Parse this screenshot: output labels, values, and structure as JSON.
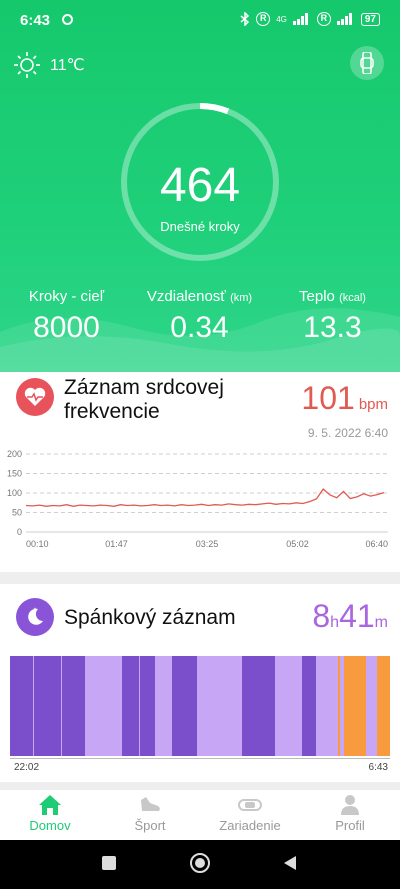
{
  "status": {
    "time": "6:43",
    "network": "4G",
    "battery": "97"
  },
  "weather": {
    "temp": "11℃"
  },
  "steps": {
    "count": "464",
    "label": "Dnešné kroky",
    "progress": 0.06
  },
  "stats": [
    {
      "label": "Kroky - cieľ",
      "unit": "",
      "value": "8000"
    },
    {
      "label": "Vzdialenosť",
      "unit": "(km)",
      "value": "0.34"
    },
    {
      "label": "Teplo",
      "unit": "(kcal)",
      "value": "13.3"
    }
  ],
  "heart": {
    "title_line1": "Záznam srdcovej",
    "title_line2": "frekvencie",
    "value": "101",
    "unit": "bpm",
    "date": "9. 5. 2022 6:40",
    "y_ticks": [
      "200",
      "150",
      "100",
      "50",
      "0"
    ],
    "x_ticks": [
      "00:10",
      "01:47",
      "03:25",
      "05:02",
      "06:40"
    ]
  },
  "chart_data": {
    "type": "line",
    "title": "Záznam srdcovej frekvencie",
    "ylim": [
      0,
      200
    ],
    "yticks": [
      0,
      50,
      100,
      150,
      200
    ],
    "x_ticks": [
      "00:10",
      "01:47",
      "03:25",
      "05:02",
      "06:40"
    ],
    "grid": true,
    "series": [
      {
        "values": [
          68,
          67,
          69,
          66,
          68,
          67,
          70,
          66,
          69,
          68,
          67,
          69,
          68,
          66,
          70,
          68,
          69,
          67,
          68,
          70,
          68,
          69,
          67,
          70,
          68,
          69,
          71,
          68,
          70,
          69,
          72,
          70,
          69,
          71,
          70,
          72,
          74,
          71,
          73,
          72,
          75,
          73,
          78,
          85,
          110,
          95,
          88,
          104,
          86,
          90,
          98,
          92,
          96,
          101
        ]
      }
    ]
  },
  "sleep": {
    "title": "Spánkový záznam",
    "hours": "8",
    "h_unit": "h",
    "minutes": "41",
    "m_unit": "m",
    "start": "22:02",
    "end": "6:43",
    "segments": [
      {
        "kind": "deep",
        "w": 0.06
      },
      {
        "kind": "light",
        "w": 0.005
      },
      {
        "kind": "deep",
        "w": 0.07
      },
      {
        "kind": "light",
        "w": 0.003
      },
      {
        "kind": "deep",
        "w": 0.063
      },
      {
        "kind": "light",
        "w": 0.097
      },
      {
        "kind": "deep",
        "w": 0.045
      },
      {
        "kind": "light",
        "w": 0.004
      },
      {
        "kind": "deep",
        "w": 0.04
      },
      {
        "kind": "light",
        "w": 0.045
      },
      {
        "kind": "deep",
        "w": 0.065
      },
      {
        "kind": "light",
        "w": 0.12
      },
      {
        "kind": "deep",
        "w": 0.088
      },
      {
        "kind": "light",
        "w": 0.072
      },
      {
        "kind": "deep",
        "w": 0.038
      },
      {
        "kind": "light",
        "w": 0.06
      },
      {
        "kind": "awake",
        "w": 0.005
      },
      {
        "kind": "light",
        "w": 0.01
      },
      {
        "kind": "awake",
        "w": 0.058
      },
      {
        "kind": "light",
        "w": 0.03
      },
      {
        "kind": "awake",
        "w": 0.034
      }
    ],
    "colors": {
      "deep": "#7b4fcb",
      "light": "#c7a7f5",
      "awake": "#f89a3e"
    }
  },
  "tabs": [
    {
      "label": "Domov",
      "icon": "home-icon",
      "active": true
    },
    {
      "label": "Šport",
      "icon": "shoe-icon",
      "active": false
    },
    {
      "label": "Zariadenie",
      "icon": "band-icon",
      "active": false
    },
    {
      "label": "Profil",
      "icon": "person-icon",
      "active": false
    }
  ],
  "colors": {
    "accent": "#1fcb74",
    "heart": "#e05a52",
    "sleep": "#a866e0"
  }
}
